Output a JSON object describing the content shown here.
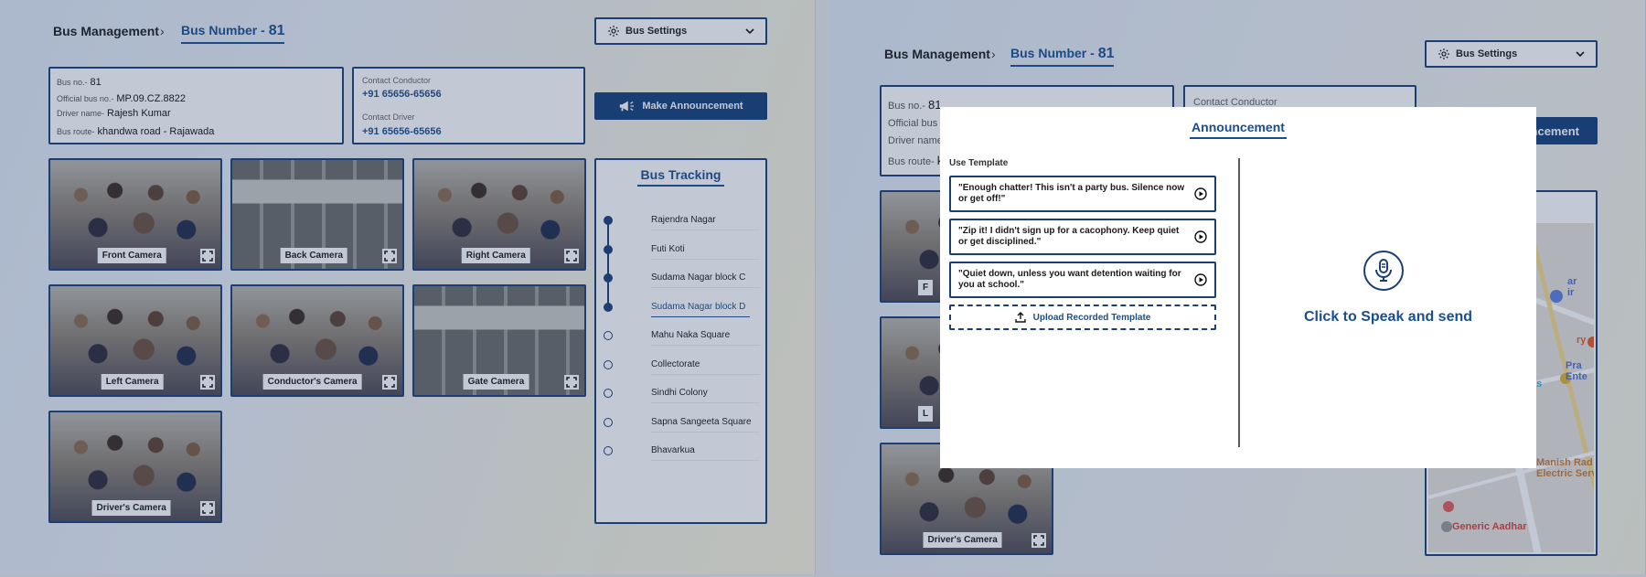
{
  "breadcrumb": {
    "root": "Bus Management",
    "separator": "›",
    "current_prefix": "Bus Number - ",
    "current_number": "81"
  },
  "settings": {
    "label": "Bus Settings",
    "icon": "gear-icon"
  },
  "bus_info": {
    "bus_no_label": "Bus no.-",
    "bus_no": "81",
    "official_label": "Official bus no.-",
    "official": "MP.09.CZ.8822",
    "driver_label": "Driver name-",
    "driver": "Rajesh Kumar",
    "route_label": "Bus route-",
    "route": "khandwa road - Rajawada"
  },
  "contacts": {
    "conductor_label": "Contact Conductor",
    "conductor": "+91 65656-65656",
    "driver_label": "Contact Driver",
    "driver": "+91 65656-65656"
  },
  "announce_button": {
    "label": "Make Announcement",
    "icon": "megaphone-icon"
  },
  "cameras": [
    {
      "label": "Front Camera",
      "scene": "crowd"
    },
    {
      "label": "Back Camera",
      "scene": "empty"
    },
    {
      "label": "Right Camera",
      "scene": "crowd"
    },
    {
      "label": "Left  Camera",
      "scene": "crowd"
    },
    {
      "label": "Conductor's Camera",
      "scene": "crowd"
    },
    {
      "label": "Gate Camera",
      "scene": "empty"
    },
    {
      "label": "Driver's Camera",
      "scene": "crowd"
    }
  ],
  "tracking": {
    "title": "Bus Tracking",
    "stops": [
      {
        "name": "Rajendra Nagar",
        "status": "passed"
      },
      {
        "name": "Futi Koti",
        "status": "passed"
      },
      {
        "name": "Sudama Nagar block C",
        "status": "passed"
      },
      {
        "name": "Sudama Nagar block D",
        "status": "current"
      },
      {
        "name": "Mahu Naka Square",
        "status": "upcoming"
      },
      {
        "name": "Collectorate",
        "status": "upcoming"
      },
      {
        "name": "Sindhi Colony",
        "status": "upcoming"
      },
      {
        "name": "Sapna Sangeeta Square",
        "status": "upcoming"
      },
      {
        "name": "Bhavarkua",
        "status": "upcoming"
      }
    ]
  },
  "right_screen": {
    "partial_info": {
      "bus_no_label": "Bus no.-",
      "bus_no": "81",
      "official_label": "Official bus r",
      "driver_label": "Driver name",
      "route_label": "Bus route-",
      "route_initial": "k",
      "conductor_label": "Contact Conductor"
    },
    "announce_partial": "ncement",
    "tracking_partial": "g",
    "cam_partial_label": "F",
    "cam_partial_label2": "L",
    "driver_cam_label": "Driver's Camera",
    "map_labels": [
      {
        "text": "ar\nir",
        "color": "#4d6fd0"
      },
      {
        "text": "ry",
        "color": "#e05a2b"
      },
      {
        "text": "Pra\nEnte",
        "color": "#4d6fd0"
      },
      {
        "text": "ss",
        "color": "#3ab0d0"
      },
      {
        "text": "Manish Rad\nElectric Serv",
        "color": "#c77a3a"
      },
      {
        "text": "Generic Aadhar",
        "color": "#d0453a"
      }
    ]
  },
  "modal": {
    "title": "Announcement",
    "use_template_label": "Use Template",
    "templates": [
      "\"Enough chatter! This isn't a party bus. Silence now or get off!\"",
      "\"Zip it! I didn't sign up for a cacophony. Keep quiet or get disciplined.\"",
      "\"Quiet down, unless you want detention waiting for you at school.\""
    ],
    "upload_label": "Upload Recorded Template",
    "speak_label": "Click to Speak and send",
    "mic_icon": "microphone-icon"
  },
  "colors": {
    "primary": "#1a3f78",
    "accent": "#1a4f8f",
    "button": "#123f7a"
  }
}
